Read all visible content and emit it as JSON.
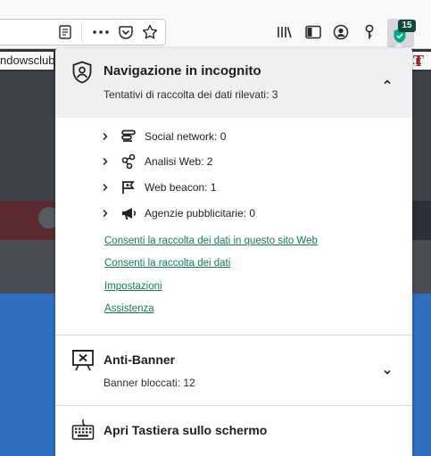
{
  "browser": {
    "bookmark_left": "ndowsclub",
    "bookmark_right": ".it",
    "page_logo_letter": "T",
    "extension_badge": "15",
    "icons": [
      "reader-view-icon",
      "more-actions-icon",
      "pocket-icon",
      "bookmark-star-icon",
      "library-icon",
      "sidebar-icon",
      "account-icon",
      "key-icon",
      "kaspersky-extension-icon"
    ]
  },
  "panel": {
    "incognito": {
      "title": "Navigazione in incognito",
      "subtitle": "Tentativi di raccolta dei dati rilevati: 3",
      "expanded": true,
      "trackers": [
        {
          "label": "Social network: 0",
          "icon": "social-network-icon"
        },
        {
          "label": "Analisi Web: 2",
          "icon": "web-analytics-icon"
        },
        {
          "label": "Web beacon: 1",
          "icon": "web-beacon-icon"
        },
        {
          "label": "Agenzie pubblicitarie: 0",
          "icon": "ad-agencies-icon"
        }
      ],
      "links": {
        "allow_site": "Consenti la raccolta dei dati in questo sito Web",
        "allow_all": "Consenti la raccolta dei dati",
        "settings": "Impostazioni",
        "support": "Assistenza"
      }
    },
    "antibanner": {
      "title": "Anti-Banner",
      "subtitle": "Banner bloccati: 12",
      "expanded": false
    },
    "keyboard": {
      "title": "Apri Tastiera sullo schermo"
    }
  },
  "colors": {
    "link": "#127a5e",
    "header_bg": "#f0f0f2",
    "badge_bg": "#0e4a3a",
    "shield_green": "#00a88e"
  }
}
